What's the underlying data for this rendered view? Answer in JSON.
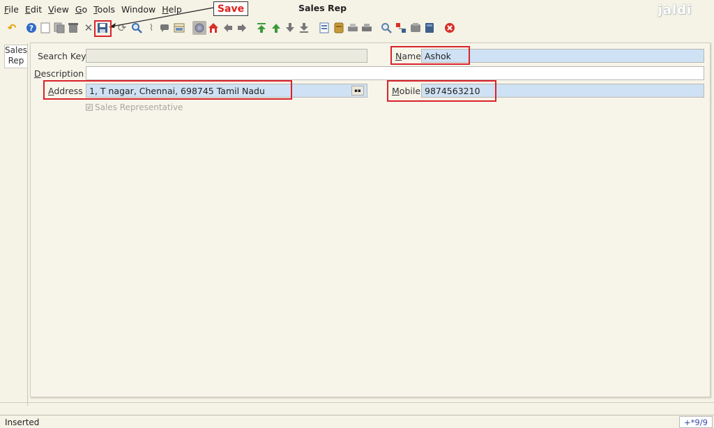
{
  "menu": {
    "items": [
      {
        "first": "F",
        "rest": "ile"
      },
      {
        "first": "E",
        "rest": "dit"
      },
      {
        "first": "V",
        "rest": "iew"
      },
      {
        "first": "G",
        "rest": "o"
      },
      {
        "first": "T",
        "rest": "ools"
      },
      {
        "first": "",
        "rest": "Window"
      },
      {
        "first": "H",
        "rest": "elp"
      }
    ]
  },
  "window": {
    "title": "Sales Rep"
  },
  "logo": {
    "text": "jaldi"
  },
  "annotation": {
    "save_label": "Save"
  },
  "tab": {
    "label_line1": "Sales",
    "label_line2": "Rep"
  },
  "form": {
    "search_key": {
      "label": "Search Key",
      "value": ""
    },
    "name": {
      "label_first": "N",
      "label_rest": "ame",
      "value": "Ashok"
    },
    "description": {
      "label_first": "D",
      "label_rest": "escription",
      "value": ""
    },
    "address": {
      "label_first": "A",
      "label_rest": "ddress",
      "value": "1, T nagar, Chennai,  698745 Tamil Nadu",
      "button_icon": "location-icon"
    },
    "mobile": {
      "label_first": "M",
      "label_rest": "obile",
      "value": "9874563210"
    },
    "sales_rep": {
      "label": "Sales Representative",
      "checked": true
    }
  },
  "status": {
    "text": "Inserted",
    "record": "+*9/9"
  },
  "colors": {
    "background": "#f5f2e6",
    "mandatory_field": "#cfe1f4",
    "annotation_red": "#d9222a",
    "record_text": "#3a4aa8"
  },
  "toolbar_icons": [
    "undo-icon",
    "help-icon",
    "new-record-icon",
    "copy-record-icon",
    "delete-icon",
    "delete-selection-icon",
    "save-icon",
    "refresh-icon",
    "find-icon",
    "attachment-icon",
    "chat-icon",
    "grid-toggle-icon",
    "history-icon",
    "home-icon",
    "previous-icon",
    "next-icon",
    "first-record-icon",
    "parent-record-icon",
    "detail-record-icon",
    "last-record-icon",
    "report-icon",
    "archive-icon",
    "print-preview-icon",
    "print-icon",
    "zoom-across-icon",
    "request-icon",
    "product-info-icon",
    "workflow-icon",
    "end-icon"
  ]
}
